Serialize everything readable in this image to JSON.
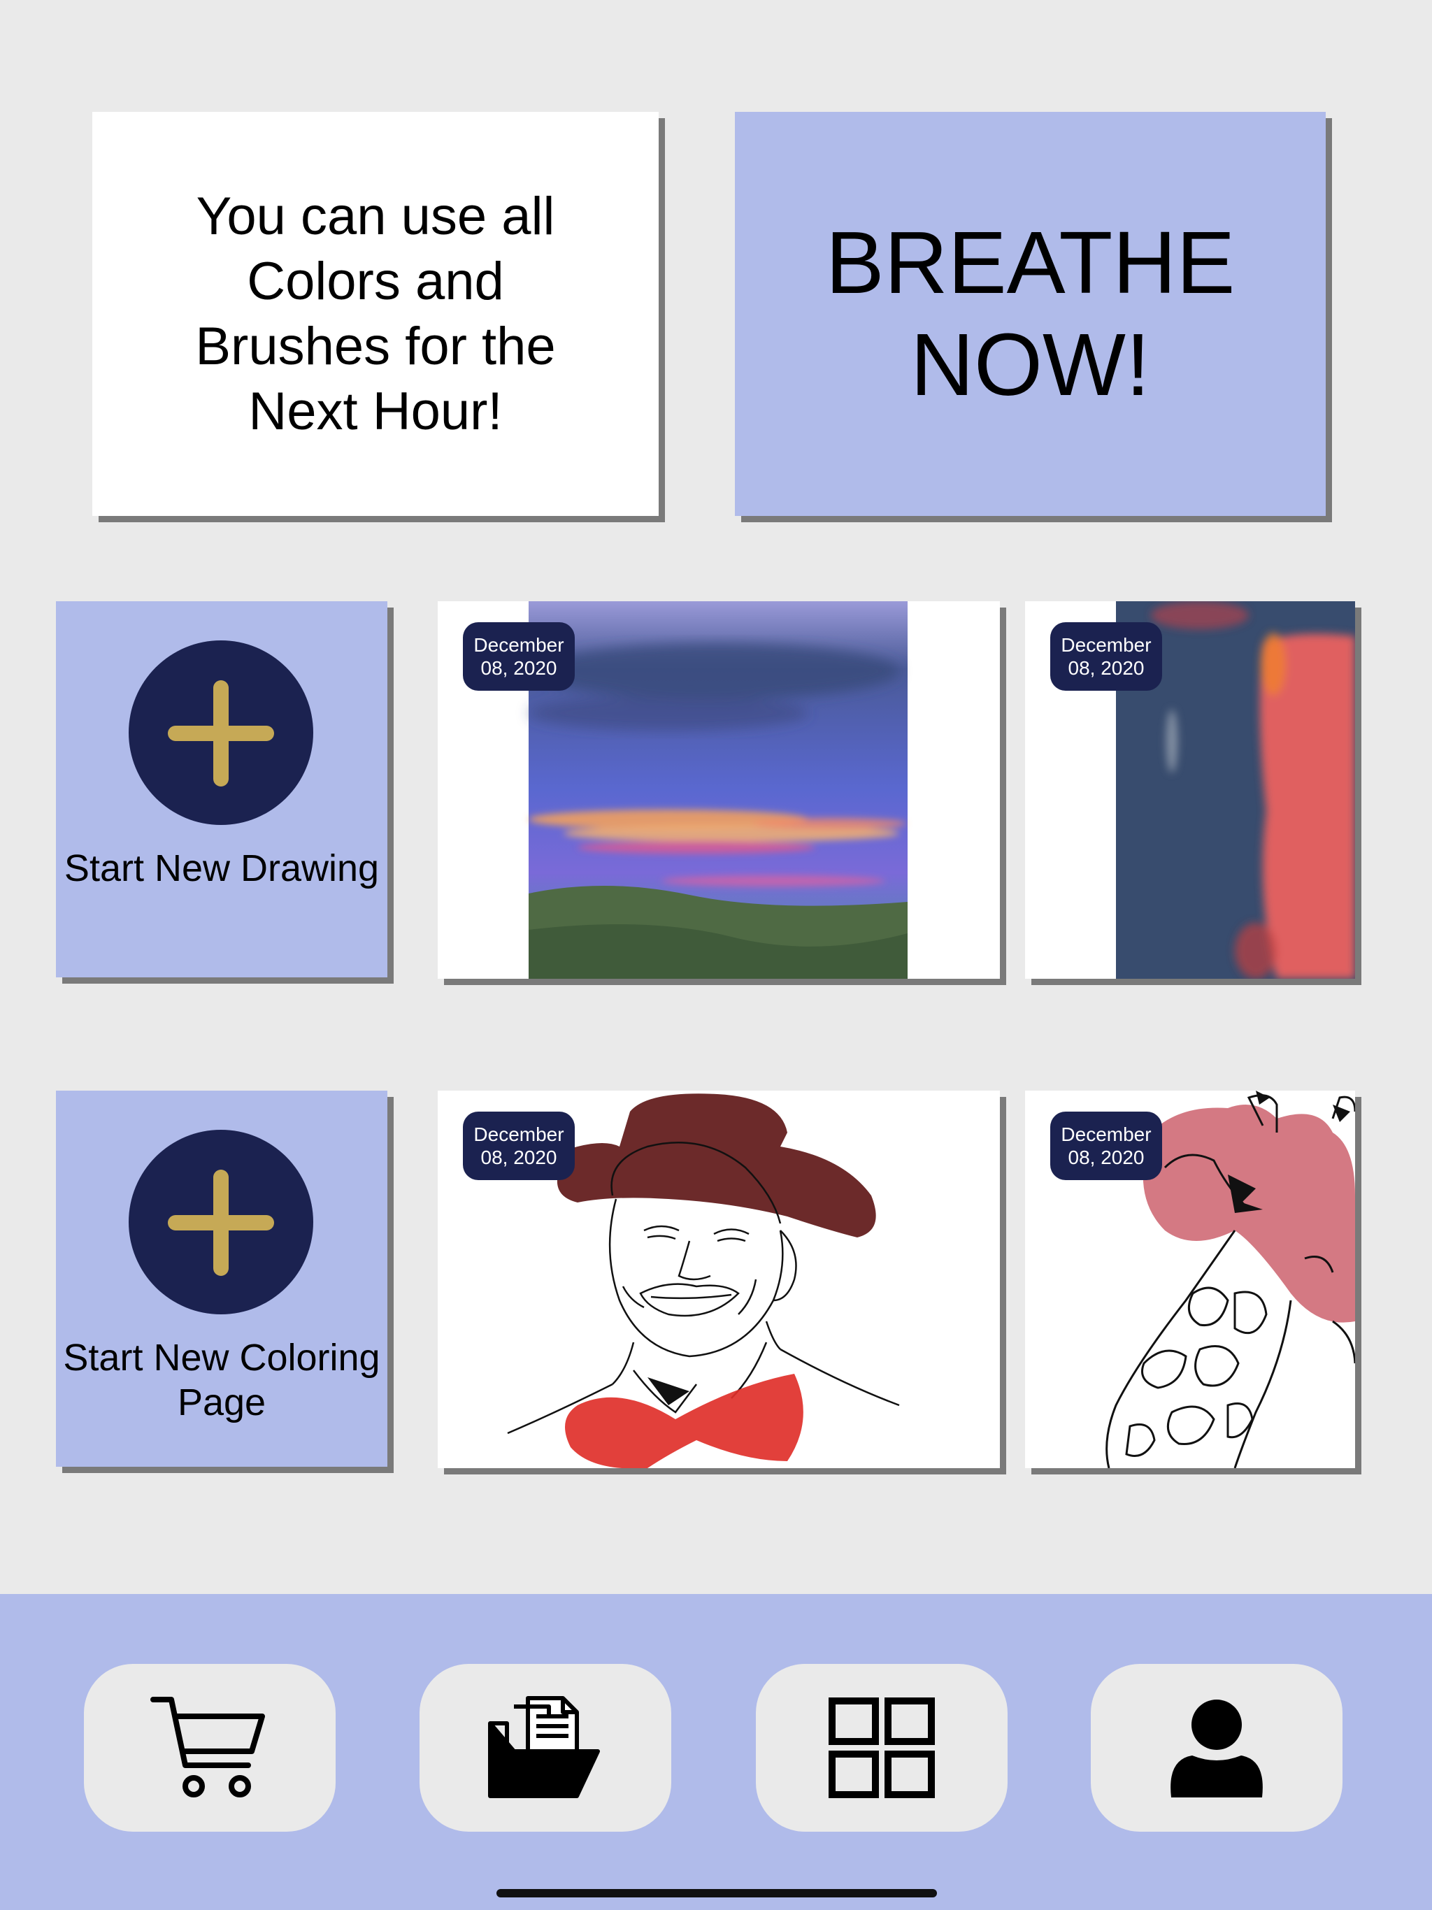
{
  "promo": {
    "unlock_text": "You can use all Colors and Brushes for the Next Hour!",
    "breathe_label": "BREATHE NOW!"
  },
  "drawings": {
    "new_label": "Start New Drawing",
    "items": [
      {
        "date_line1": "December",
        "date_line2": "08, 2020"
      },
      {
        "date_line1": "December",
        "date_line2": "08, 2020"
      }
    ]
  },
  "coloring": {
    "new_label": "Start New Coloring Page",
    "items": [
      {
        "date_line1": "December",
        "date_line2": "08, 2020"
      },
      {
        "date_line1": "December",
        "date_line2": "08, 2020"
      }
    ]
  },
  "nav": {
    "items": [
      {
        "icon": "cart-icon"
      },
      {
        "icon": "folder-documents-icon"
      },
      {
        "icon": "grid-icon"
      },
      {
        "icon": "user-icon"
      }
    ]
  },
  "colors": {
    "accent": "#b0bbea",
    "navy": "#1b2250",
    "gold": "#c6a956",
    "background": "#eaeaea"
  }
}
